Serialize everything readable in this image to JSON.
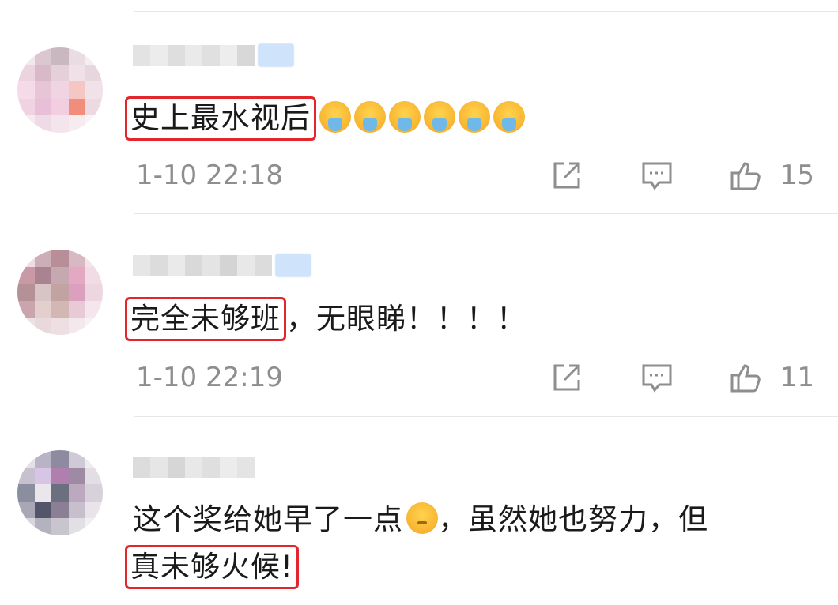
{
  "comments": [
    {
      "username": "",
      "text_highlight": "史上最水视后",
      "text_after": "",
      "emoji_count": 6,
      "time": "1-10 22:18",
      "likes": "15"
    },
    {
      "username": "",
      "text_highlight": "完全未够班",
      "text_after": "，无眼睇！！！！",
      "time": "1-10 22:19",
      "likes": "11"
    },
    {
      "username": "",
      "line1": "这个奖给她早了一点",
      "line1_after": "，虽然她也努力，但",
      "line2_highlight": "真未够火候!"
    }
  ],
  "icons": {
    "share": "share-icon",
    "reply": "comment-icon",
    "like": "thumbs-up-icon"
  },
  "colors": {
    "highlight_border": "#e3262b",
    "meta_text": "#8e8e8e",
    "body_text": "#1a1a1a"
  }
}
